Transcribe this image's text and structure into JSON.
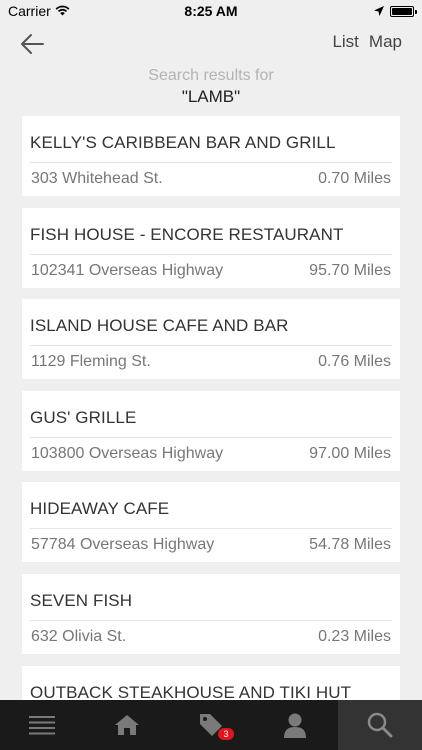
{
  "status_bar": {
    "carrier": "Carrier",
    "time": "8:25 AM",
    "battery_level": 1.0
  },
  "nav": {
    "list_label": "List",
    "map_label": "Map"
  },
  "search": {
    "caption": "Search results for",
    "term": "\"LAMB\""
  },
  "results": [
    {
      "name": "KELLY'S CARIBBEAN BAR AND GRILL",
      "address": "303 Whitehead St.",
      "distance": "0.70 Miles"
    },
    {
      "name": "FISH HOUSE - ENCORE RESTAURANT",
      "address": "102341 Overseas Highway",
      "distance": "95.70 Miles"
    },
    {
      "name": "ISLAND HOUSE CAFE AND BAR",
      "address": "1129 Fleming St.",
      "distance": "0.76 Miles"
    },
    {
      "name": "GUS' GRILLE",
      "address": "103800 Overseas Highway",
      "distance": "97.00 Miles"
    },
    {
      "name": "HIDEAWAY CAFE",
      "address": "57784 Overseas Highway",
      "distance": "54.78 Miles"
    },
    {
      "name": "SEVEN FISH",
      "address": "632 Olivia St.",
      "distance": "0.23 Miles"
    },
    {
      "name": "OUTBACK STEAKHOUSE AND TIKI HUT",
      "address": "",
      "distance": ""
    }
  ],
  "tab_bar": {
    "tabs": [
      {
        "icon": "menu-icon"
      },
      {
        "icon": "home-icon"
      },
      {
        "icon": "tag-icon",
        "badge": "3"
      },
      {
        "icon": "profile-icon"
      },
      {
        "icon": "search-icon",
        "active": true
      }
    ],
    "badge_color": "#e0161c",
    "active_color": "#333333"
  }
}
